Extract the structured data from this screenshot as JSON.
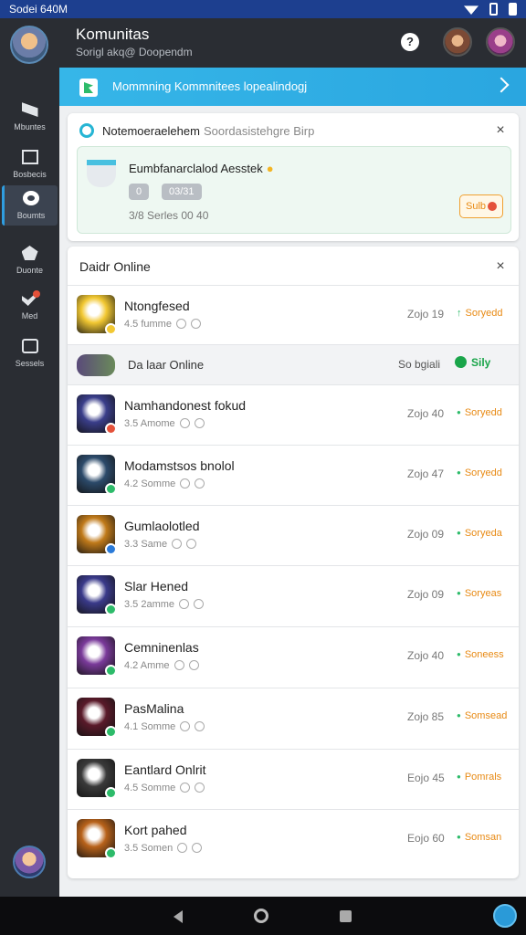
{
  "status": {
    "time": "Sodei 640M"
  },
  "header": {
    "title": "Komunitas",
    "subtitle": "Sorigl akq@ Doopendm"
  },
  "sidebar": {
    "items": [
      {
        "label": "Mbuntes"
      },
      {
        "label": "Bosbecis"
      },
      {
        "label": "Boumts"
      },
      {
        "label": "Duonte"
      },
      {
        "label": "Med"
      },
      {
        "label": "Sessels"
      }
    ]
  },
  "banner": {
    "text": "Mommning Kommnitees lopealindogj"
  },
  "notification": {
    "title": "Notemoeraelehem",
    "subtitle": "Soordasistehgre Birp",
    "item_title": "Eumbfanarclalod Aesstek",
    "chip1": "0",
    "chip2": "03/31",
    "meta": "3/8 Serles 00 40",
    "button": "Sulb"
  },
  "list": {
    "header": "Daidr Online",
    "section": {
      "title": "Da laar Online",
      "meta": "So bgiali",
      "status": "Sily"
    },
    "rows": [
      {
        "name": "Ntongfesed",
        "sub": "4.5 fumme",
        "time": "Zojo 19",
        "status": "Soryedd",
        "thumb_color": "#f2c832",
        "badge_color": "#f2c832"
      },
      {
        "name": "Namhandonest fokud",
        "sub": "3.5 Amome",
        "time": "Zojo 40",
        "status": "Soryedd",
        "thumb_color": "#3a3e8a",
        "badge_color": "#e4513a"
      },
      {
        "name": "Modamstsos bnolol",
        "sub": "4.2 Somme",
        "time": "Zojo 47",
        "status": "Soryedd",
        "thumb_color": "#2c4a6a",
        "badge_color": "#2dbb6a"
      },
      {
        "name": "Gumlaolotled",
        "sub": "3.3 Same",
        "time": "Zojo 09",
        "status": "Soryeda",
        "thumb_color": "#c07a1a",
        "badge_color": "#2a7ad8"
      },
      {
        "name": "Slar Hened",
        "sub": "3.5 2amme",
        "time": "Zojo 09",
        "status": "Soryeas",
        "thumb_color": "#3a3a8a",
        "badge_color": "#2dbb6a"
      },
      {
        "name": "Cemninenlas",
        "sub": "4.2 Amme",
        "time": "Zojo 40",
        "status": "Soneess",
        "thumb_color": "#7a3a9a",
        "badge_color": "#2dbb6a"
      },
      {
        "name": "PasMalina",
        "sub": "4.1 Somme",
        "time": "Zojo 85",
        "status": "Somsead",
        "thumb_color": "#5a1a2a",
        "badge_color": "#2dbb6a"
      },
      {
        "name": "Eantlard Onlrit",
        "sub": "4.5 Somme",
        "time": "Eojo 45",
        "status": "Pomrals",
        "thumb_color": "#3a3a3a",
        "badge_color": "#2dbb6a"
      },
      {
        "name": "Kort pahed",
        "sub": "3.5 Somen",
        "time": "Eojo 60",
        "status": "Somsan",
        "thumb_color": "#b8621a",
        "badge_color": "#2dbb6a"
      }
    ]
  }
}
